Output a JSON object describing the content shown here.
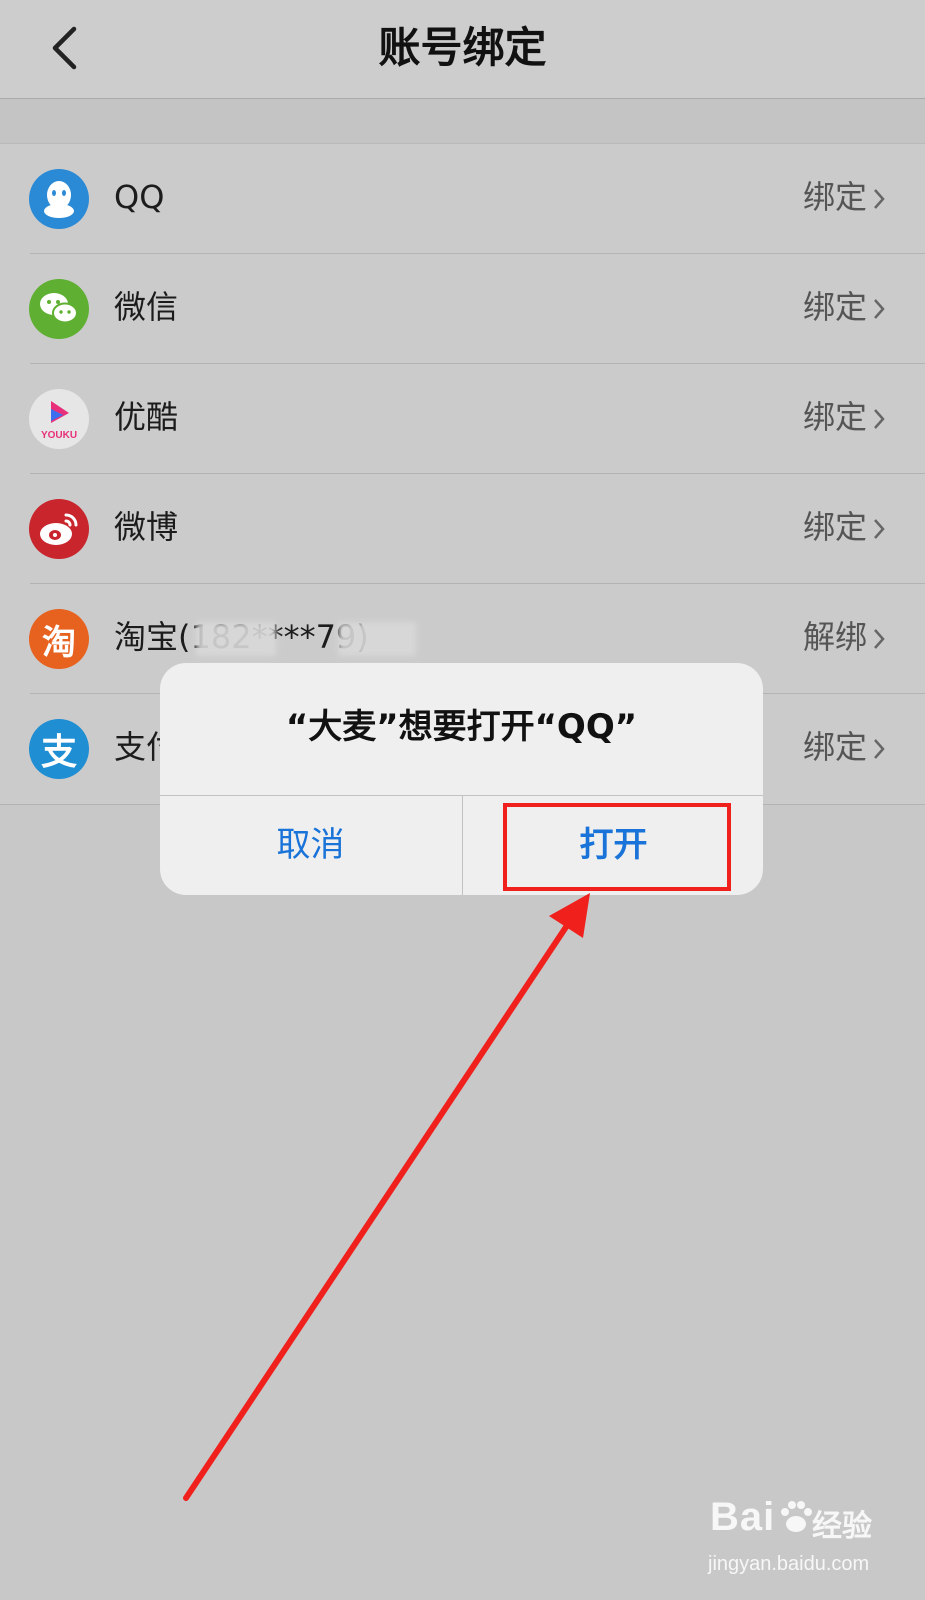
{
  "header": {
    "title": "账号绑定",
    "back_icon": "chevron-left-icon"
  },
  "accounts": [
    {
      "name": "QQ",
      "action": "绑定",
      "icon": "qq-icon",
      "color": "#2b8ad6"
    },
    {
      "name": "微信",
      "action": "绑定",
      "icon": "wechat-icon",
      "color": "#5fb032"
    },
    {
      "name": "优酷",
      "action": "绑定",
      "icon": "youku-icon",
      "color": "#e6e6e6"
    },
    {
      "name": "微博",
      "action": "绑定",
      "icon": "weibo-icon",
      "color": "#c9252d"
    },
    {
      "name": "淘宝(182****79)",
      "action": "解绑",
      "icon": "taobao-icon",
      "color": "#e7621f"
    },
    {
      "name": "支付宝",
      "action": "绑定",
      "icon": "alipay-icon",
      "color": "#1f8ed3"
    }
  ],
  "icon_glyphs": {
    "youku": "YOUKU",
    "taobao": "淘",
    "alipay": "支"
  },
  "dialog": {
    "message": "“大麦”想要打开“QQ”",
    "cancel": "取消",
    "open": "打开"
  },
  "watermark": {
    "logo": "Bai",
    "text": "经验",
    "url": "jingyan.baidu.com"
  },
  "colors": {
    "accent": "#1a73d8",
    "highlight": "#f0201c"
  }
}
